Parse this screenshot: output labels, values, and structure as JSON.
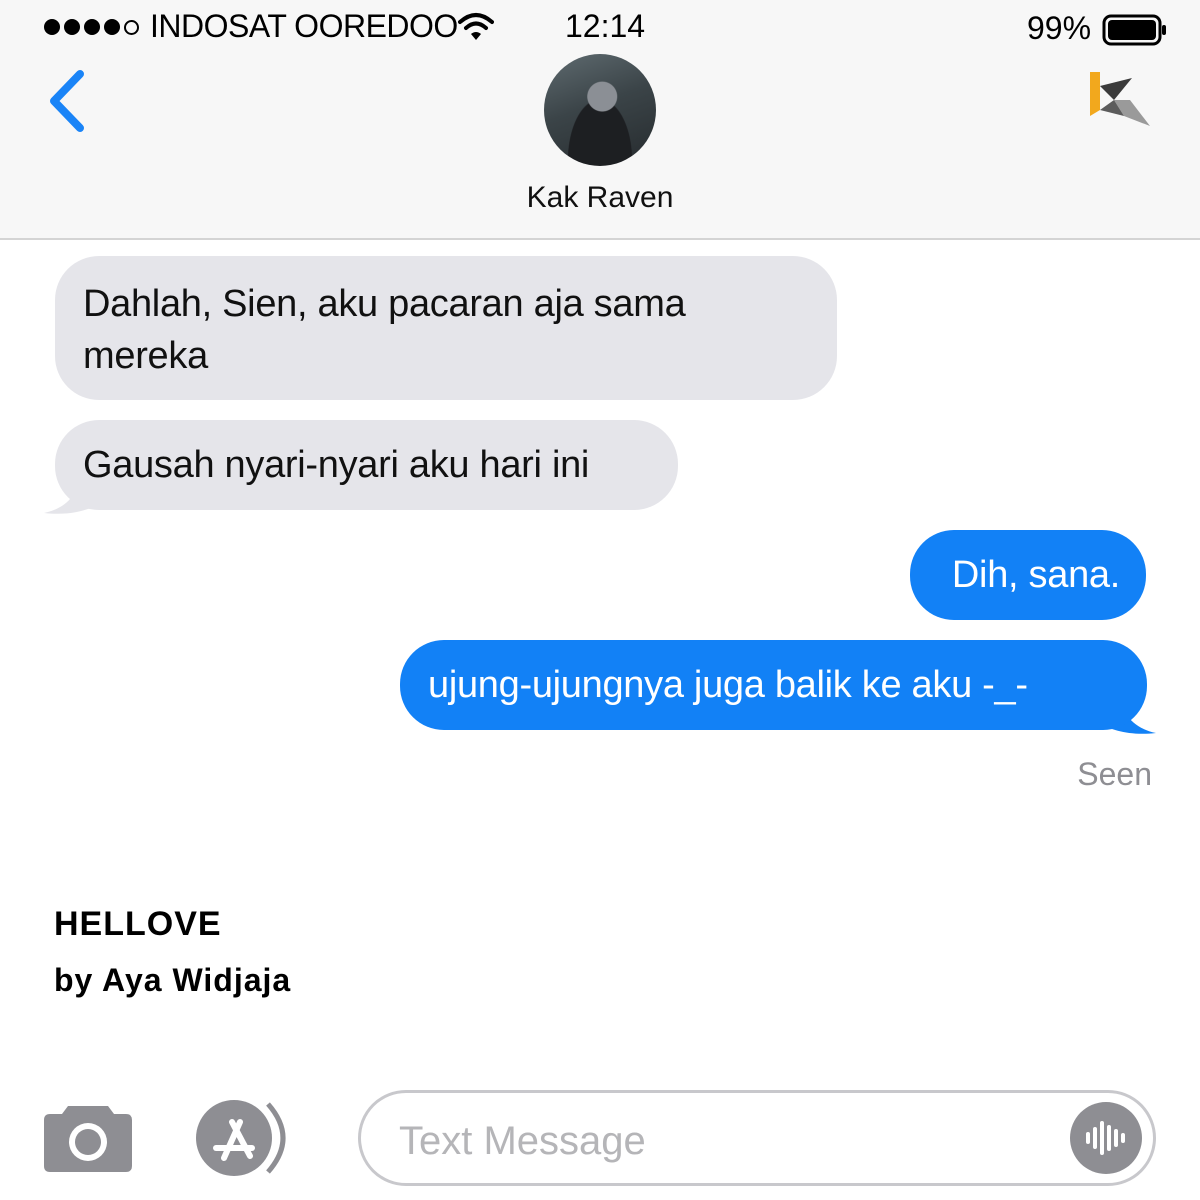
{
  "status_bar": {
    "carrier": "INDOSAT OOREDOO",
    "time": "12:14",
    "battery": "99%",
    "signal_bars": 4,
    "signal_max": 5
  },
  "header": {
    "contact_name": "Kak Raven",
    "back_icon": "chevron-left-icon",
    "logo_icon": "k-logo-icon"
  },
  "messages": [
    {
      "direction": "incoming",
      "text": "Dahlah, Sien, aku pacaran aja sama mereka"
    },
    {
      "direction": "incoming",
      "text": "Gausah nyari-nyari aku hari ini"
    },
    {
      "direction": "outgoing",
      "text": "Dih, sana."
    },
    {
      "direction": "outgoing",
      "text": "ujung-ujungnya juga balik ke aku -_-"
    }
  ],
  "seen_label": "Seen",
  "story": {
    "title": "HELLOVE",
    "author": "by Aya Widjaja"
  },
  "composer": {
    "placeholder": "Text Message",
    "camera_icon": "camera-icon",
    "apps_icon": "app-store-icon",
    "voice_icon": "voice-waveform-icon"
  },
  "colors": {
    "incoming_bubble": "#e5e5ea",
    "outgoing_bubble": "#1281f6",
    "accent": "#1a84f7",
    "header_bg": "#f7f7f7"
  }
}
